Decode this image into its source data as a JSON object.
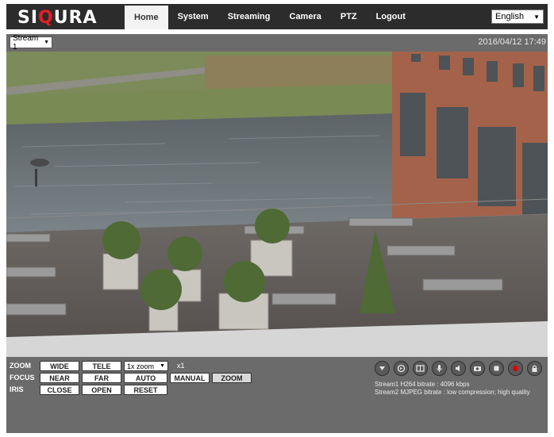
{
  "brand": {
    "logo_left": "SI",
    "logo_accent": "Q",
    "logo_right": "URA"
  },
  "nav": {
    "items": [
      {
        "label": "Home",
        "active": true
      },
      {
        "label": "System"
      },
      {
        "label": "Streaming"
      },
      {
        "label": "Camera"
      },
      {
        "label": "PTZ"
      },
      {
        "label": "Logout"
      }
    ]
  },
  "language": {
    "selected": "English"
  },
  "stream": {
    "selected": "Stream 1"
  },
  "timestamp": "2016/04/12 17:49",
  "controls": {
    "zoom": {
      "label": "ZOOM",
      "wide": "WIDE",
      "tele": "TELE",
      "zoom_select": "1x zoom",
      "factor": "x1"
    },
    "focus": {
      "label": "FOCUS",
      "near": "NEAR",
      "far": "FAR",
      "auto": "AUTO",
      "manual": "MANUAL",
      "zoom": "ZOOM"
    },
    "iris": {
      "label": "IRIS",
      "close": "CLOSE",
      "open": "OPEN",
      "reset": "RESET"
    }
  },
  "icons": [
    "chevron-down-icon",
    "talk-icon",
    "snapshot-grid-icon",
    "microphone-icon",
    "speaker-icon",
    "camera-icon",
    "stop-icon",
    "record-icon",
    "lock-icon"
  ],
  "status": {
    "stream1": "Stream1 H264 bitrate : 4096 kbps",
    "stream2": "Stream2 MJPEG bitrate : low compression; high quality"
  },
  "colors": {
    "accent": "#e41e26",
    "header": "#2c2c2c",
    "panel": "#6b6b6b",
    "record": "#e00000"
  }
}
